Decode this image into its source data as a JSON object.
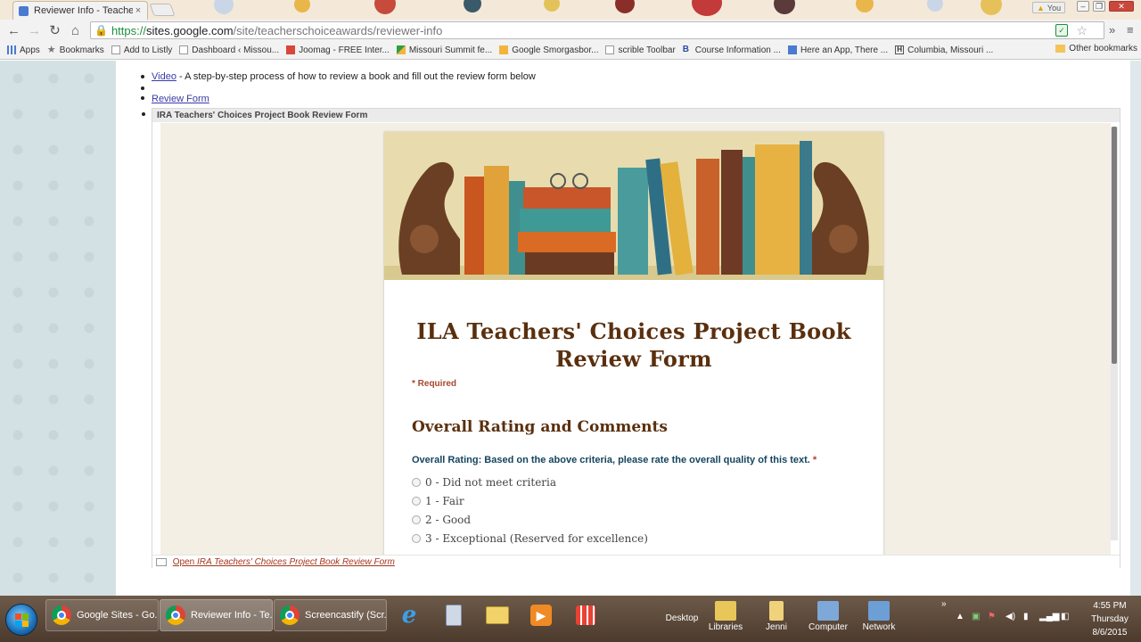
{
  "browser": {
    "tab_title": "Reviewer Info - Teachers",
    "tab_close": "×",
    "user_label": "You",
    "url_scheme": "https://",
    "url_host": "sites.google.com",
    "url_path": "/site/teacherschoiceawards/reviewer-info",
    "bookmarks": [
      {
        "label": "Apps",
        "icon": "apps-grid-icon",
        "color": "#4a7bd0"
      },
      {
        "label": "Bookmarks",
        "icon": "star-icon",
        "color": "#777777"
      },
      {
        "label": "Add to Listly",
        "icon": "page-icon",
        "color": "#999999"
      },
      {
        "label": "Dashboard ‹ Missou...",
        "icon": "page-icon",
        "color": "#999999"
      },
      {
        "label": "Joomag - FREE Inter...",
        "icon": "joomag-icon",
        "color": "#d9463c"
      },
      {
        "label": "Missouri Summit fe...",
        "icon": "drive-icon",
        "color": "#2f9e44"
      },
      {
        "label": "Google Smorgasbor...",
        "icon": "folder-icon",
        "color": "#f2b53a"
      },
      {
        "label": "scrible Toolbar",
        "icon": "page-icon",
        "color": "#999999"
      },
      {
        "label": "Course Information ...",
        "icon": "blackboard-icon",
        "color": "#2a4fa0"
      },
      {
        "label": "Here an App, There ...",
        "icon": "docs-icon",
        "color": "#4a7bd0"
      },
      {
        "label": "Columbia, Missouri ...",
        "icon": "h-icon",
        "color": "#555555"
      }
    ],
    "other_bookmarks": "Other bookmarks"
  },
  "page": {
    "bullets": [
      {
        "link": "Video",
        "text": " - A step-by-step process of how to review a book and fill out the review form below"
      },
      {
        "link": "",
        "text": ""
      },
      {
        "link": "Review Form",
        "text": ""
      }
    ],
    "embed_header": "IRA Teachers' Choices Project Book Review Form",
    "form": {
      "title": "ILA Teachers' Choices Project Book Review Form",
      "required_note": "* Required",
      "section_title": "Overall Rating and Comments",
      "question": "Overall Rating: Based on the above criteria, please rate the overall quality of this text.",
      "question_required": "*",
      "options": [
        "0 - Did not meet criteria",
        "1 - Fair",
        "2 - Good",
        "3 - Exceptional (Reserved for excellence)"
      ]
    },
    "embed_footer_prefix": "Open",
    "embed_footer_link": "IRA Teachers' Choices Project Book Review Form"
  },
  "taskbar": {
    "items": [
      {
        "label": "Google Sites - Go...",
        "active": false
      },
      {
        "label": "Reviewer Info - Te...",
        "active": true
      },
      {
        "label": "Screencastify (Scr...",
        "active": false
      }
    ],
    "desktop_items": [
      "Desktop",
      "Libraries",
      "Jenni",
      "Computer",
      "Network"
    ],
    "time": "4:55 PM",
    "day": "Thursday",
    "date": "8/6/2015"
  }
}
